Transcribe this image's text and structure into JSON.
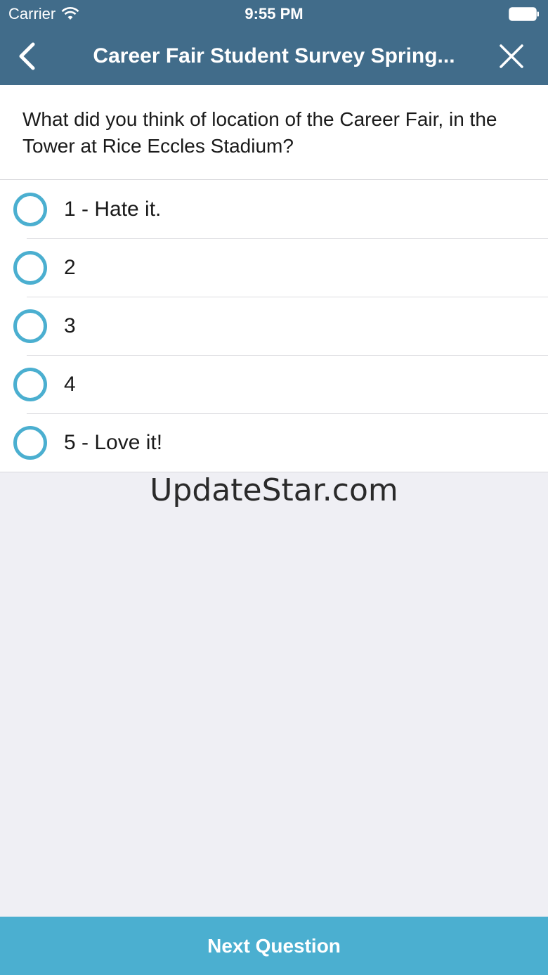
{
  "status_bar": {
    "carrier": "Carrier",
    "time": "9:55 PM"
  },
  "nav": {
    "title": "Career Fair Student Survey Spring...",
    "back_icon": "chevron-left-icon",
    "close_icon": "close-icon"
  },
  "question": {
    "text": "What did you think of location of the Career Fair, in the Tower at Rice Eccles Stadium?"
  },
  "options": [
    {
      "label": "1 - Hate it."
    },
    {
      "label": "2"
    },
    {
      "label": "3"
    },
    {
      "label": "4"
    },
    {
      "label": "5 - Love it!"
    }
  ],
  "watermark": "UpdateStar.com",
  "footer": {
    "next_label": "Next Question"
  },
  "colors": {
    "header": "#416c8a",
    "accent": "#4bafd0",
    "background": "#efeff4"
  }
}
